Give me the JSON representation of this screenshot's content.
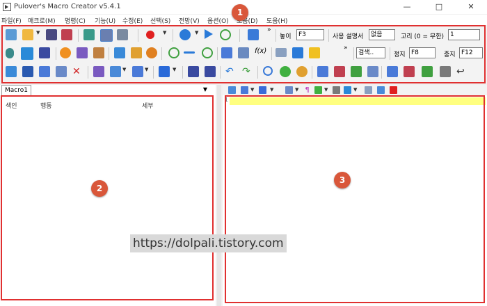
{
  "window": {
    "title": "Pulover's Macro Creator v5.4.1",
    "controls": {
      "minimize": "—",
      "maximize": "□",
      "close": "✕"
    }
  },
  "menu": [
    "파일(F)",
    "매크로(M)",
    "명령(C)",
    "기능(U)",
    "수정(E)",
    "선택(S)",
    "전망(V)",
    "옵션(O)",
    "도움(D)",
    "도움(H)"
  ],
  "toolbar": {
    "play_label": "놓이",
    "play_hotkey": "F3",
    "user_desc_label": "사용 설명서",
    "user_desc_value": "없음",
    "loop_label": "고리 (0 = 무한)",
    "loop_value": "1",
    "search_placeholder": "검색..",
    "stop_label": "정지",
    "stop_hotkey": "F8",
    "pause_label": "중지",
    "pause_hotkey": "F12",
    "overflow": "»"
  },
  "left_pane": {
    "tab": "Macro1",
    "tab_dropdown": "▼",
    "columns": [
      "색인",
      "행동",
      "세부"
    ]
  },
  "editor": {
    "line_number": "1"
  },
  "annotations": [
    "1",
    "2",
    "3"
  ],
  "watermark": "https://dolpali.tistory.com",
  "colors": {
    "annotation_red": "#e03030",
    "badge": "#d9573a",
    "line_highlight": "#ffff80"
  }
}
